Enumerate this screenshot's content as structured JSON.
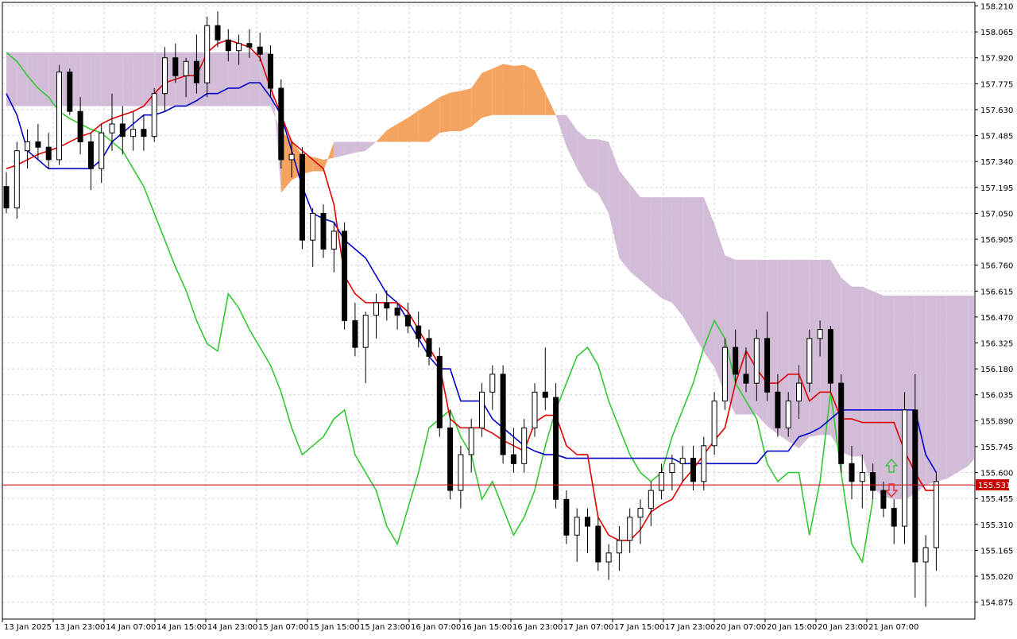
{
  "chart_data": {
    "type": "candlestick",
    "indicator": "ichimoku",
    "y_ticks": [
      "158.210",
      "158.065",
      "157.920",
      "157.775",
      "157.630",
      "157.485",
      "157.340",
      "157.195",
      "157.050",
      "156.905",
      "156.760",
      "156.615",
      "156.470",
      "156.325",
      "156.180",
      "156.035",
      "155.890",
      "155.745",
      "155.600",
      "155.455",
      "155.310",
      "155.165",
      "155.020",
      "154.875"
    ],
    "ylim": [
      154.78,
      158.23
    ],
    "x_ticks": [
      "13 Jan 2025",
      "13 Jan 23:00",
      "14 Jan 07:00",
      "14 Jan 15:00",
      "14 Jan 23:00",
      "15 Jan 07:00",
      "15 Jan 15:00",
      "15 Jan 23:00",
      "16 Jan 07:00",
      "16 Jan 15:00",
      "16 Jan 23:00",
      "17 Jan 07:00",
      "17 Jan 15:00",
      "17 Jan 23:00",
      "20 Jan 07:00",
      "20 Jan 15:00",
      "20 Jan 23:00",
      "21 Jan 07:00"
    ],
    "current_price": "155.531",
    "colors": {
      "tenkan": "#e00000",
      "kijun": "#0000c8",
      "chikou": "#32c832",
      "cloud_bearish": "#d2bcd8",
      "cloud_bullish": "#f4a460",
      "price_line": "#c80000",
      "bull_candle": "#ffffff",
      "bear_candle": "#000000",
      "arrow_up": "#32c832",
      "arrow_down": "#e03030"
    },
    "candles": [
      [
        157.2,
        157.28,
        157.05,
        157.08
      ],
      [
        157.08,
        157.45,
        157.02,
        157.4
      ],
      [
        157.4,
        157.52,
        157.3,
        157.45
      ],
      [
        157.45,
        157.55,
        157.35,
        157.42
      ],
      [
        157.42,
        157.5,
        157.3,
        157.35
      ],
      [
        157.35,
        157.88,
        157.32,
        157.84
      ],
      [
        157.84,
        157.86,
        157.6,
        157.62
      ],
      [
        157.62,
        157.7,
        157.38,
        157.45
      ],
      [
        157.45,
        157.5,
        157.18,
        157.3
      ],
      [
        157.3,
        157.55,
        157.22,
        157.5
      ],
      [
        157.5,
        157.72,
        157.4,
        157.55
      ],
      [
        157.55,
        157.65,
        157.38,
        157.48
      ],
      [
        157.48,
        157.62,
        157.4,
        157.52
      ],
      [
        157.52,
        157.6,
        157.4,
        157.48
      ],
      [
        157.48,
        157.75,
        157.45,
        157.72
      ],
      [
        157.72,
        157.98,
        157.62,
        157.92
      ],
      [
        157.92,
        158.0,
        157.78,
        157.82
      ],
      [
        157.82,
        157.92,
        157.7,
        157.9
      ],
      [
        157.9,
        158.05,
        157.72,
        157.78
      ],
      [
        157.78,
        158.15,
        157.7,
        158.1
      ],
      [
        158.1,
        158.18,
        157.98,
        158.02
      ],
      [
        158.02,
        158.08,
        157.9,
        157.96
      ],
      [
        157.96,
        158.05,
        157.88,
        158.0
      ],
      [
        158.0,
        158.08,
        157.92,
        157.98
      ],
      [
        157.98,
        158.06,
        157.9,
        157.94
      ],
      [
        157.94,
        157.99,
        157.7,
        157.75
      ],
      [
        157.75,
        157.8,
        157.3,
        157.35
      ],
      [
        157.35,
        157.45,
        157.25,
        157.38
      ],
      [
        157.38,
        157.42,
        156.85,
        156.9
      ],
      [
        156.9,
        157.08,
        156.75,
        157.05
      ],
      [
        157.05,
        157.1,
        156.8,
        156.85
      ],
      [
        156.85,
        157.0,
        156.72,
        156.95
      ],
      [
        156.95,
        157.0,
        156.4,
        156.45
      ],
      [
        156.45,
        156.55,
        156.25,
        156.3
      ],
      [
        156.3,
        156.5,
        156.1,
        156.48
      ],
      [
        156.48,
        156.6,
        156.35,
        156.55
      ],
      [
        156.55,
        156.62,
        156.45,
        156.52
      ],
      [
        156.52,
        156.55,
        156.4,
        156.48
      ],
      [
        156.48,
        156.55,
        156.38,
        156.42
      ],
      [
        156.42,
        156.5,
        156.3,
        156.35
      ],
      [
        156.35,
        156.4,
        156.2,
        156.25
      ],
      [
        156.25,
        156.3,
        155.8,
        155.85
      ],
      [
        155.85,
        155.95,
        155.45,
        155.5
      ],
      [
        155.5,
        155.75,
        155.4,
        155.7
      ],
      [
        155.7,
        155.9,
        155.6,
        155.85
      ],
      [
        155.85,
        156.1,
        155.8,
        156.05
      ],
      [
        156.05,
        156.2,
        155.95,
        156.15
      ],
      [
        156.15,
        156.2,
        155.65,
        155.7
      ],
      [
        155.7,
        155.85,
        155.6,
        155.65
      ],
      [
        155.65,
        155.9,
        155.6,
        155.85
      ],
      [
        155.85,
        156.1,
        155.8,
        156.05
      ],
      [
        156.05,
        156.3,
        155.95,
        156.02
      ],
      [
        156.02,
        156.1,
        155.4,
        155.45
      ],
      [
        155.45,
        155.5,
        155.2,
        155.25
      ],
      [
        155.25,
        155.4,
        155.1,
        155.35
      ],
      [
        155.35,
        155.4,
        155.15,
        155.3
      ],
      [
        155.3,
        155.35,
        155.05,
        155.1
      ],
      [
        155.1,
        155.2,
        155.0,
        155.15
      ],
      [
        155.15,
        155.3,
        155.05,
        155.22
      ],
      [
        155.22,
        155.4,
        155.15,
        155.35
      ],
      [
        155.35,
        155.45,
        155.2,
        155.4
      ],
      [
        155.4,
        155.55,
        155.3,
        155.5
      ],
      [
        155.5,
        155.65,
        155.45,
        155.6
      ],
      [
        155.6,
        155.7,
        155.5,
        155.65
      ],
      [
        155.65,
        155.75,
        155.55,
        155.68
      ],
      [
        155.68,
        155.75,
        155.5,
        155.55
      ],
      [
        155.55,
        155.8,
        155.5,
        155.75
      ],
      [
        155.75,
        156.05,
        155.7,
        156.0
      ],
      [
        156.0,
        156.35,
        155.95,
        156.3
      ],
      [
        156.3,
        156.4,
        156.1,
        156.15
      ],
      [
        156.15,
        156.3,
        156.05,
        156.1
      ],
      [
        156.1,
        156.4,
        156.0,
        156.35
      ],
      [
        156.35,
        156.5,
        156.0,
        156.05
      ],
      [
        156.05,
        156.15,
        155.8,
        155.85
      ],
      [
        155.85,
        156.05,
        155.8,
        156.0
      ],
      [
        156.0,
        156.2,
        155.9,
        156.1
      ],
      [
        156.1,
        156.4,
        156.05,
        156.35
      ],
      [
        156.35,
        156.45,
        156.25,
        156.4
      ],
      [
        156.4,
        156.42,
        156.05,
        156.1
      ],
      [
        156.1,
        156.15,
        155.6,
        155.65
      ],
      [
        155.65,
        155.75,
        155.45,
        155.55
      ],
      [
        155.55,
        155.7,
        155.4,
        155.6
      ],
      [
        155.6,
        155.65,
        155.45,
        155.5
      ],
      [
        155.5,
        155.55,
        155.35,
        155.4
      ],
      [
        155.4,
        155.45,
        155.2,
        155.3
      ],
      [
        155.3,
        156.05,
        155.2,
        155.95
      ],
      [
        155.95,
        156.15,
        154.9,
        155.1
      ],
      [
        155.1,
        155.25,
        154.85,
        155.18
      ],
      [
        155.18,
        155.6,
        155.05,
        155.55
      ]
    ],
    "tenkan": [
      157.3,
      157.32,
      157.35,
      157.38,
      157.4,
      157.42,
      157.45,
      157.48,
      157.5,
      157.55,
      157.58,
      157.6,
      157.62,
      157.65,
      157.72,
      157.78,
      157.8,
      157.82,
      157.82,
      157.95,
      158.0,
      158.02,
      158.0,
      157.98,
      157.92,
      157.75,
      157.6,
      157.45,
      157.4,
      157.35,
      157.3,
      157.1,
      156.7,
      156.6,
      156.55,
      156.55,
      156.55,
      156.55,
      156.5,
      156.4,
      156.3,
      156.2,
      155.9,
      155.85,
      155.85,
      155.85,
      155.82,
      155.78,
      155.75,
      155.72,
      155.88,
      155.92,
      155.92,
      155.75,
      155.7,
      155.7,
      155.35,
      155.25,
      155.22,
      155.22,
      155.28,
      155.38,
      155.42,
      155.45,
      155.55,
      155.62,
      155.7,
      155.78,
      155.85,
      156.1,
      156.28,
      156.18,
      156.1,
      156.1,
      156.15,
      156.15,
      156.0,
      156.05,
      156.05,
      155.9,
      155.9,
      155.88,
      155.88,
      155.88,
      155.88,
      155.72,
      155.6,
      155.5,
      155.5
    ],
    "kijun": [
      157.72,
      157.6,
      157.4,
      157.35,
      157.3,
      157.3,
      157.3,
      157.3,
      157.3,
      157.35,
      157.45,
      157.5,
      157.55,
      157.6,
      157.6,
      157.62,
      157.65,
      157.65,
      157.68,
      157.72,
      157.72,
      157.75,
      157.75,
      157.78,
      157.78,
      157.7,
      157.6,
      157.4,
      157.2,
      157.05,
      157.02,
      157.0,
      156.9,
      156.85,
      156.8,
      156.7,
      156.6,
      156.55,
      156.45,
      156.35,
      156.25,
      156.18,
      156.18,
      156.0,
      156.0,
      156.0,
      155.9,
      155.85,
      155.8,
      155.75,
      155.72,
      155.7,
      155.7,
      155.68,
      155.68,
      155.68,
      155.68,
      155.68,
      155.68,
      155.68,
      155.68,
      155.68,
      155.68,
      155.68,
      155.65,
      155.65,
      155.65,
      155.65,
      155.65,
      155.65,
      155.65,
      155.65,
      155.72,
      155.72,
      155.72,
      155.8,
      155.82,
      155.85,
      155.9,
      155.95,
      155.95,
      155.95,
      155.95,
      155.95,
      155.95,
      155.95,
      155.95,
      155.7,
      155.6
    ],
    "chikou": [
      157.95,
      157.9,
      157.82,
      157.75,
      157.7,
      157.62,
      157.58,
      157.55,
      157.52,
      157.5,
      157.45,
      157.4,
      157.3,
      157.2,
      157.05,
      156.9,
      156.75,
      156.62,
      156.45,
      156.32,
      156.28,
      156.6,
      156.52,
      156.4,
      156.3,
      156.2,
      156.05,
      155.85,
      155.7,
      155.75,
      155.8,
      155.9,
      155.95,
      155.7,
      155.6,
      155.5,
      155.3,
      155.2,
      155.4,
      155.6,
      155.85,
      155.9,
      155.95,
      155.8,
      155.7,
      155.45,
      155.55,
      155.4,
      155.25,
      155.35,
      155.5,
      155.75,
      155.95,
      156.1,
      156.25,
      156.3,
      156.2,
      156.0,
      155.85,
      155.7,
      155.6,
      155.55,
      155.6,
      155.8,
      155.95,
      156.1,
      156.3,
      156.45,
      156.35,
      156.1,
      156.0,
      155.9,
      155.65,
      155.55,
      155.6,
      155.6,
      155.25,
      155.55,
      156.05,
      155.6,
      155.2,
      155.1,
      155.45
    ]
  }
}
